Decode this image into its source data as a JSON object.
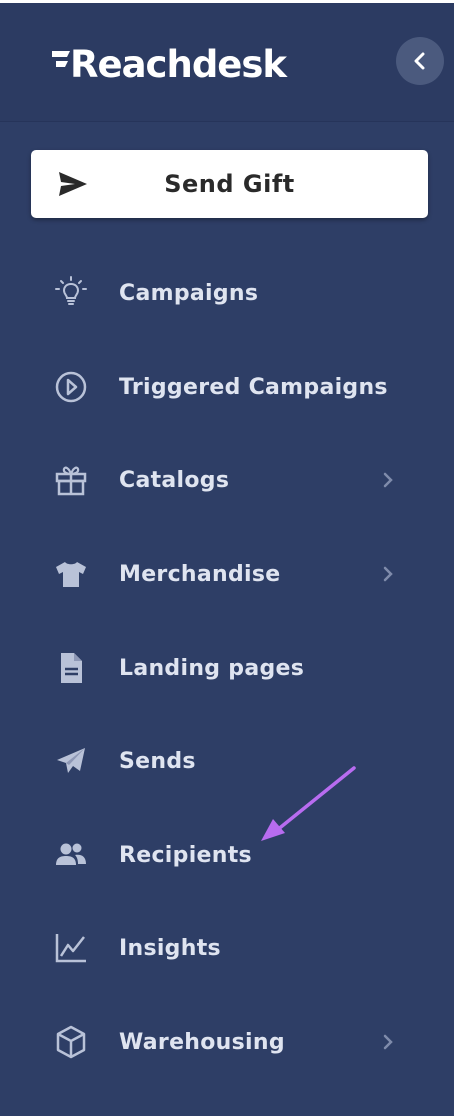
{
  "brand": {
    "name": "Reachdesk"
  },
  "send_gift": {
    "label": "Send Gift"
  },
  "nav": {
    "items": [
      {
        "label": "Campaigns",
        "icon": "lightbulb-icon",
        "has_submenu": false
      },
      {
        "label": "Triggered Campaigns",
        "icon": "play-circle-icon",
        "has_submenu": false
      },
      {
        "label": "Catalogs",
        "icon": "gift-icon",
        "has_submenu": true
      },
      {
        "label": "Merchandise",
        "icon": "tshirt-icon",
        "has_submenu": true
      },
      {
        "label": "Landing pages",
        "icon": "document-icon",
        "has_submenu": false
      },
      {
        "label": "Sends",
        "icon": "paper-plane-icon",
        "has_submenu": false
      },
      {
        "label": "Recipients",
        "icon": "users-icon",
        "has_submenu": false
      },
      {
        "label": "Insights",
        "icon": "line-chart-icon",
        "has_submenu": false
      },
      {
        "label": "Warehousing",
        "icon": "box-icon",
        "has_submenu": true
      }
    ]
  },
  "colors": {
    "sidebar_bg": "#2e3e66",
    "header_bg": "#2c3b62",
    "text": "#dfe4f0",
    "icon": "#b9c2d8",
    "annotation_arrow": "#b86cf0"
  }
}
